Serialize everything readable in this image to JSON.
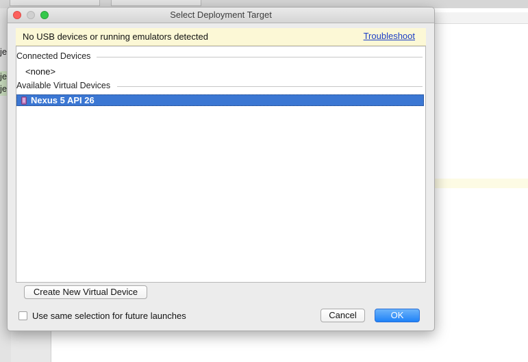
{
  "background": {
    "left_fragments": [
      "je",
      "je",
      "je"
    ]
  },
  "dialog": {
    "title": "Select Deployment Target",
    "warning": {
      "text": "No USB devices or running emulators detected",
      "link": "Troubleshoot"
    },
    "connected_devices": {
      "header": "Connected Devices",
      "empty_label": "<none>"
    },
    "available_virtual_devices": {
      "header": "Available Virtual Devices",
      "items": [
        {
          "label": "Nexus 5 API 26",
          "icon": "phone-icon",
          "selected": true
        }
      ]
    },
    "create_button": "Create New Virtual Device",
    "checkbox": {
      "label": "Use same selection for future launches",
      "checked": false
    },
    "cancel_button": "Cancel",
    "ok_button": "OK"
  },
  "colors": {
    "selection": "#3b77d3",
    "warning_bg": "#fcf8d6",
    "link": "#1c3ec6",
    "ok_button": "#1f82f7",
    "close": "#fc605c",
    "zoom": "#34c84a"
  }
}
